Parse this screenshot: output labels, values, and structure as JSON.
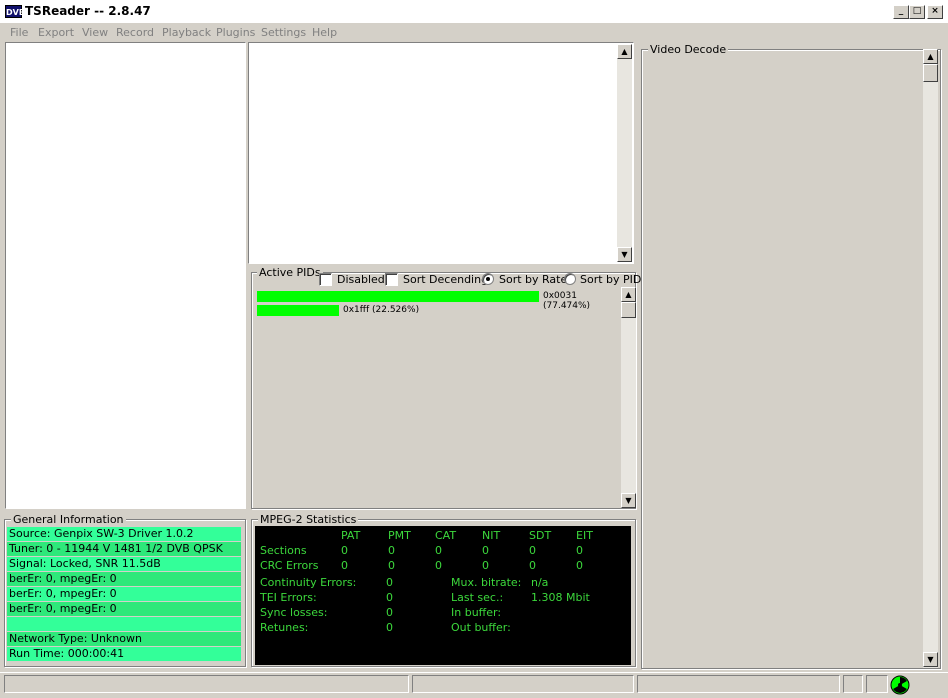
{
  "window": {
    "logo": "DVB",
    "title": "TSReader -- 2.8.47",
    "minimize": "_",
    "maximize": "□",
    "close": "×"
  },
  "menu": [
    "File",
    "Export",
    "View",
    "Record",
    "Playback",
    "Plugins",
    "Settings",
    "Help"
  ],
  "video_decode": {
    "label": "Video Decode"
  },
  "active_pids": {
    "label": "Active PIDs",
    "disabled_label": "Disabled",
    "sort_descending_label": "Sort Decending",
    "sort_by_rate_label": "Sort by Rate",
    "sort_by_pid_label": "Sort by PID",
    "disabled_checked": false,
    "sort_descending_checked": false,
    "sort_mode": "rate",
    "pids": [
      {
        "label": "0x0031 (77.474%)",
        "percent": 77.474
      },
      {
        "label": "0x1fff (22.526%)",
        "percent": 22.526
      }
    ]
  },
  "general_info": {
    "label": "General Information",
    "rows": [
      "Source: Genpix SW-3 Driver 1.0.2",
      "Tuner: 0 - 11944 V 1481 1/2 DVB QPSK",
      "Signal: Locked, SNR 11.5dB",
      "berEr: 0, mpegEr: 0",
      "berEr: 0, mpegEr: 0",
      "berEr: 0, mpegEr: 0",
      "",
      "Network Type: Unknown",
      "Run Time: 000:00:41"
    ]
  },
  "mpeg_stats": {
    "label": "MPEG-2 Statistics",
    "columns": [
      "PAT",
      "PMT",
      "CAT",
      "NIT",
      "SDT",
      "EIT"
    ],
    "sections_label": "Sections",
    "sections": [
      "0",
      "0",
      "0",
      "0",
      "0",
      "0"
    ],
    "crc_label": "CRC Errors",
    "crc": [
      "0",
      "0",
      "0",
      "0",
      "0",
      "0"
    ],
    "continuity_label": "Continuity Errors:",
    "continuity": "0",
    "tei_label": "TEI Errors:",
    "tei": "0",
    "sync_label": "Sync losses:",
    "sync": "0",
    "retunes_label": "Retunes:",
    "retunes": "0",
    "mux_label": "Mux. bitrate:",
    "mux": "n/a",
    "last_label": "Last sec.:",
    "last": "1.308 Mbit",
    "in_label": "In buffer:",
    "out_label": "Out buffer:"
  },
  "colors": {
    "pid_bar": "#00ff00",
    "info_row": "#33ff99",
    "stats_text": "#3cd83c"
  }
}
